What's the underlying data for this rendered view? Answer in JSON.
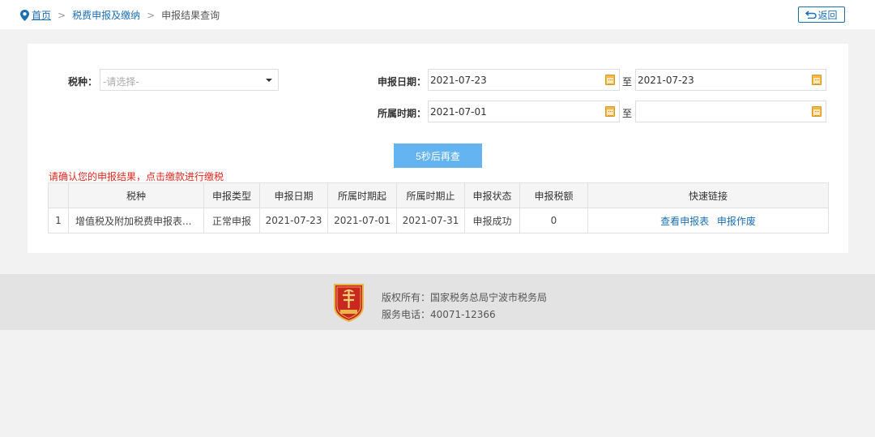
{
  "breadcrumb": {
    "home": "首页",
    "sep1": ">",
    "section": "税费申报及缴纳",
    "sep2": ">",
    "current": "申报结果查询"
  },
  "back_label": "返回",
  "form": {
    "tax_type_label": "税种：",
    "tax_type_placeholder": "-请选择-",
    "declare_date_label": "申报日期：",
    "declare_date_from": "2021-07-23",
    "declare_date_to": "2021-07-23",
    "period_label": "所属时期：",
    "period_from": "2021-07-01",
    "period_to": "",
    "to_label": "至"
  },
  "recheck_button": "5秒后再查",
  "warning": "请确认您的申报结果，点击缴款进行缴税",
  "table": {
    "headers": [
      "",
      "税种",
      "申报类型",
      "申报日期",
      "所属时期起",
      "所属时期止",
      "申报状态",
      "申报税额",
      "快速链接"
    ],
    "rows": [
      {
        "index": "1",
        "tax_type": "增值税及附加税费申报表...",
        "declare_type": "正常申报",
        "declare_date": "2021-07-23",
        "period_start": "2021-07-01",
        "period_end": "2021-07-31",
        "status": "申报成功",
        "amount": "0",
        "link_view": "查看申报表",
        "link_void": "申报作废"
      }
    ]
  },
  "footer": {
    "copyright": "版权所有：国家税务总局宁波市税务局",
    "phone": "服务电话：40071-12366"
  },
  "colors": {
    "link": "#1a6fb3",
    "button": "#63b4f0",
    "warning": "#e4281f",
    "footer_bg": "#e3e3e3"
  }
}
